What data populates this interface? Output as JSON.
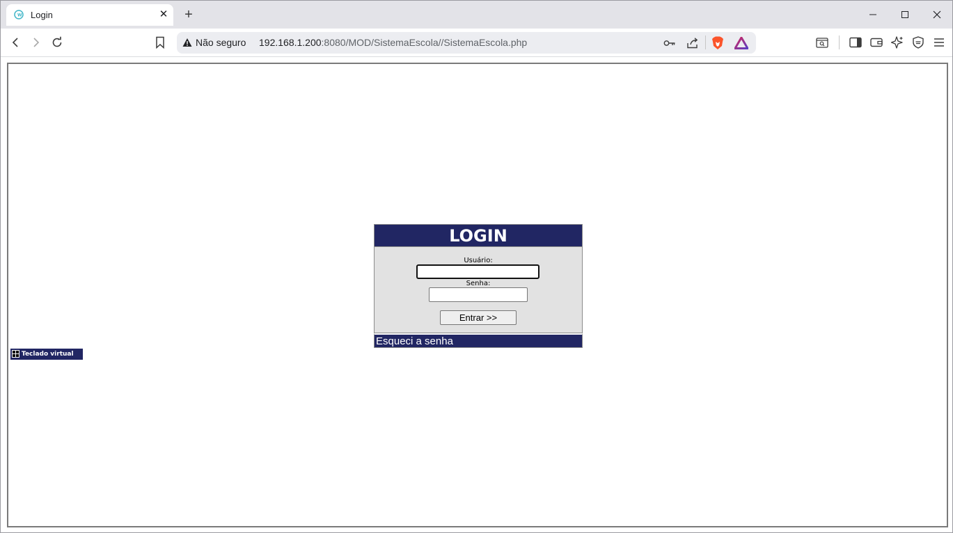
{
  "tab": {
    "title": "Login",
    "close_glyph": "✕",
    "new_tab_glyph": "+"
  },
  "window_controls": {
    "minimize": "minimize-icon",
    "maximize": "maximize-icon",
    "close": "close-icon"
  },
  "address_bar": {
    "security_label": "Não seguro",
    "url_host": "192.168.1.200",
    "url_rest": ":8080/MOD/SistemaEscola//SistemaEscola.php"
  },
  "login": {
    "title": "LOGIN",
    "user_label": "Usuário:",
    "user_value": "",
    "password_label": "Senha:",
    "password_value": "",
    "submit_label": "Entrar >>",
    "forgot_label": "Esqueci a senha"
  },
  "virtual_keyboard": {
    "label": "Teclado virtual"
  },
  "colors": {
    "header_bg": "#212663",
    "form_bg": "#e2e2e2",
    "brave_orange": "#fb542b"
  }
}
